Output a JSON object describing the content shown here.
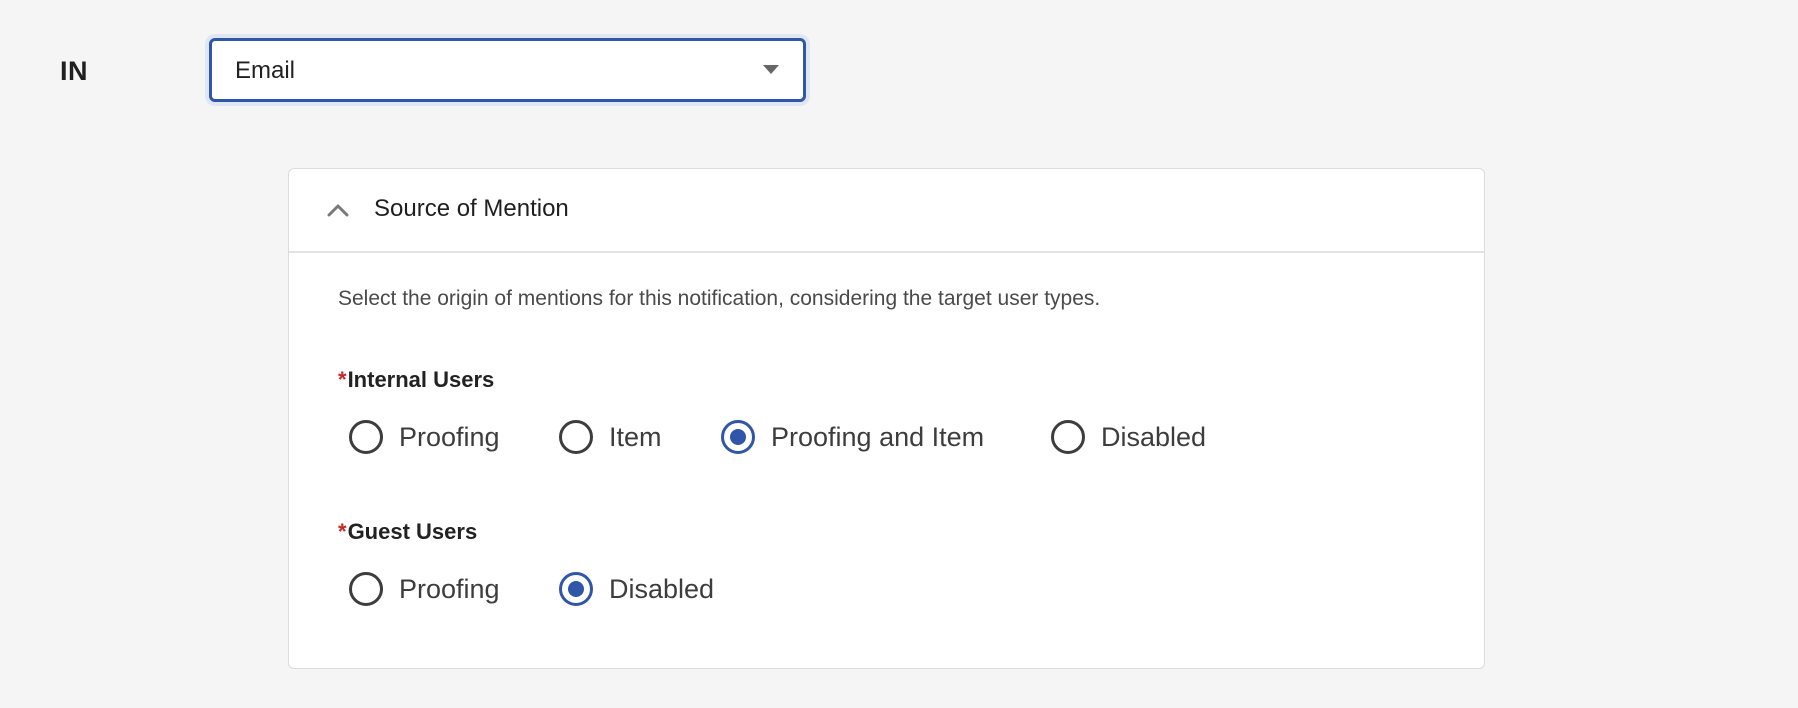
{
  "channel": {
    "label": "IN",
    "selected": "Email"
  },
  "panel": {
    "title": "Source of Mention",
    "description": "Select the origin of mentions for this notification, considering the target user types.",
    "internal_users": {
      "label": "Internal Users",
      "required_mark": "*",
      "options": [
        "Proofing",
        "Item",
        "Proofing and Item",
        "Disabled"
      ],
      "selected": "Proofing and Item"
    },
    "guest_users": {
      "label": "Guest Users",
      "required_mark": "*",
      "options": [
        "Proofing",
        "Disabled"
      ],
      "selected": "Disabled"
    }
  },
  "colors": {
    "accent": "#2f56a8",
    "required": "#c62828",
    "panel_bg": "#ffffff",
    "page_bg": "#f5f5f5"
  },
  "icons": {
    "dropdown": "caret-down-icon",
    "collapse": "chevron-up-icon"
  }
}
